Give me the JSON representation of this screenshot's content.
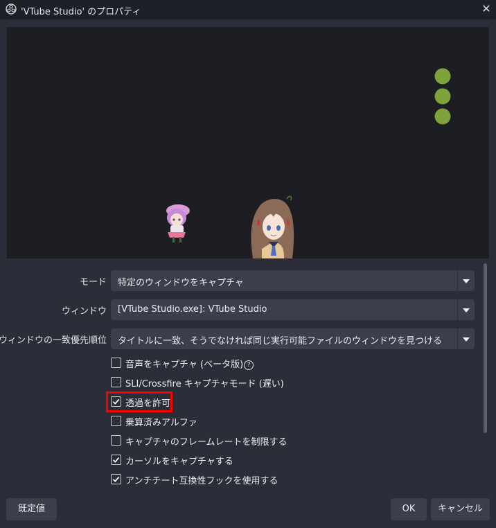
{
  "window": {
    "title": "'VTube Studio' のプロパティ",
    "close_glyph": "✕"
  },
  "form": {
    "mode_label": "モード",
    "mode_value": "特定のウィンドウをキャプチャ",
    "window_label": "ウィンドウ",
    "window_value": "[VTube Studio.exe]: VTube Studio",
    "priority_label": "ウィンドウの一致優先順位",
    "priority_value": "タイトルに一致、そうでなければ同じ実行可能ファイルのウィンドウを見つける"
  },
  "checkboxes": [
    {
      "label": "音声をキャプチャ (ベータ版)",
      "checked": false
    },
    {
      "label": "SLI/Crossfire キャプチャモード (遅い)",
      "checked": false
    },
    {
      "label": "透過を許可",
      "checked": true
    },
    {
      "label": "乗算済みアルファ",
      "checked": false
    },
    {
      "label": "キャプチャのフレームレートを制限する",
      "checked": false
    },
    {
      "label": "カーソルをキャプチャする",
      "checked": true
    },
    {
      "label": "アンチチート互換性フックを使用する",
      "checked": true
    }
  ],
  "help_glyph": "?",
  "buttons": {
    "defaults": "既定値",
    "ok": "OK",
    "cancel": "キャンセル"
  },
  "colors": {
    "highlight": "#ff0000",
    "preview_dots": "#7fa33b"
  }
}
